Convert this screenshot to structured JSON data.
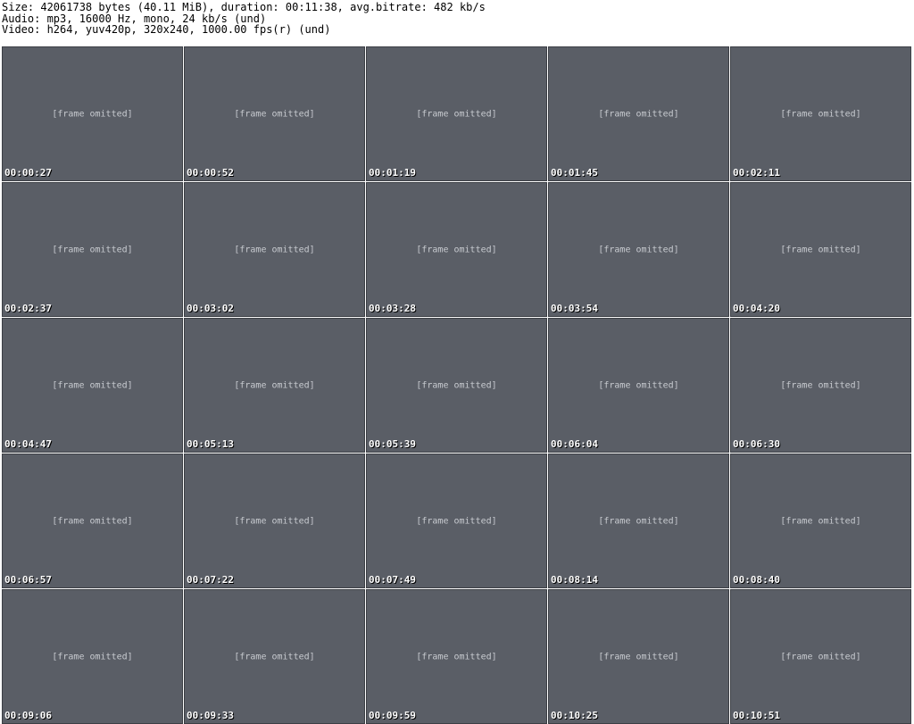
{
  "header": {
    "size_line": "Size: 42061738 bytes (40.11 MiB), duration: 00:11:38, avg.bitrate: 482 kb/s",
    "audio_line": "Audio: mp3, 16000 Hz, mono, 24 kb/s (und)",
    "video_line": "Video: h264, yuv420p, 320x240, 1000.00 fps(r) (und)"
  },
  "placeholder_text": "[frame omitted]",
  "timestamps": [
    "00:00:27",
    "00:00:52",
    "00:01:19",
    "00:01:45",
    "00:02:11",
    "00:02:37",
    "00:03:02",
    "00:03:28",
    "00:03:54",
    "00:04:20",
    "00:04:47",
    "00:05:13",
    "00:05:39",
    "00:06:04",
    "00:06:30",
    "00:06:57",
    "00:07:22",
    "00:07:49",
    "00:08:14",
    "00:08:40",
    "00:09:06",
    "00:09:33",
    "00:09:59",
    "00:10:25",
    "00:10:51"
  ]
}
